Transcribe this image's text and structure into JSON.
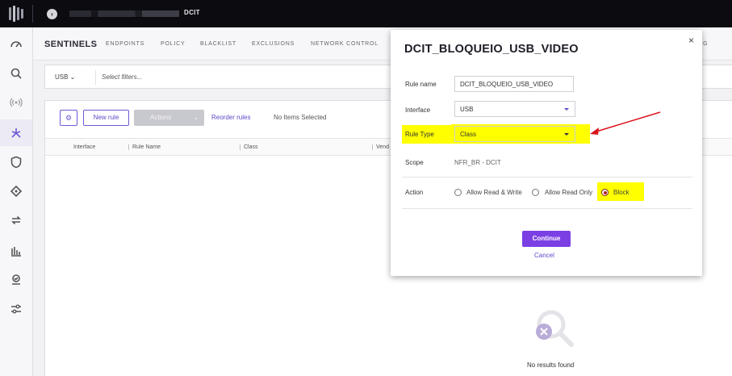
{
  "topbar": {
    "site_label": "DCIT"
  },
  "sidebar": {
    "items": [
      {
        "icon": "dashboard-icon"
      },
      {
        "icon": "search-icon"
      },
      {
        "icon": "broadcast-icon"
      },
      {
        "icon": "sentinel-icon",
        "active": true
      },
      {
        "icon": "shield-icon"
      },
      {
        "icon": "diamond-icon"
      },
      {
        "icon": "sync-icon"
      },
      {
        "icon": "chart-icon"
      },
      {
        "icon": "monitor-icon"
      },
      {
        "icon": "sliders-icon"
      }
    ]
  },
  "header": {
    "brand": "SENTINELS",
    "nav": [
      "ENDPOINTS",
      "POLICY",
      "BLACKLIST",
      "EXCLUSIONS",
      "NETWORK CONTROL"
    ],
    "nav_tail": "G"
  },
  "filterbar": {
    "type": "USB ⌄",
    "placeholder": "Select filters..."
  },
  "toolbar": {
    "new_rule": "New rule",
    "actions": "Actions",
    "reorder": "Reorder rules",
    "selection": "No Items Selected"
  },
  "table": {
    "columns": [
      "Interface",
      "Rule Name",
      "Class",
      "Vend"
    ],
    "empty_text": "No results found"
  },
  "modal": {
    "title": "DCIT_BLOQUEIO_USB_VIDEO",
    "close": "×",
    "fields": {
      "rule_name_label": "Rule name",
      "rule_name_value": "DCIT_BLOQUEIO_USB_VIDEO",
      "interface_label": "Interface",
      "interface_value": "USB",
      "rule_type_label": "Rule Type",
      "rule_type_value": "Class",
      "scope_label": "Scope",
      "scope_value": "NFR_BR - DCIT",
      "action_label": "Action"
    },
    "actions": [
      {
        "label": "Allow Read & Write",
        "selected": false
      },
      {
        "label": "Allow Read Only",
        "selected": false
      },
      {
        "label": "Block",
        "selected": true
      }
    ],
    "continue": "Continue",
    "cancel": "Cancel"
  },
  "colors": {
    "accent": "#6b5bd6",
    "primary_button": "#7b3fe4",
    "highlight": "#ffff00",
    "annotation_arrow": "#d9151b"
  }
}
